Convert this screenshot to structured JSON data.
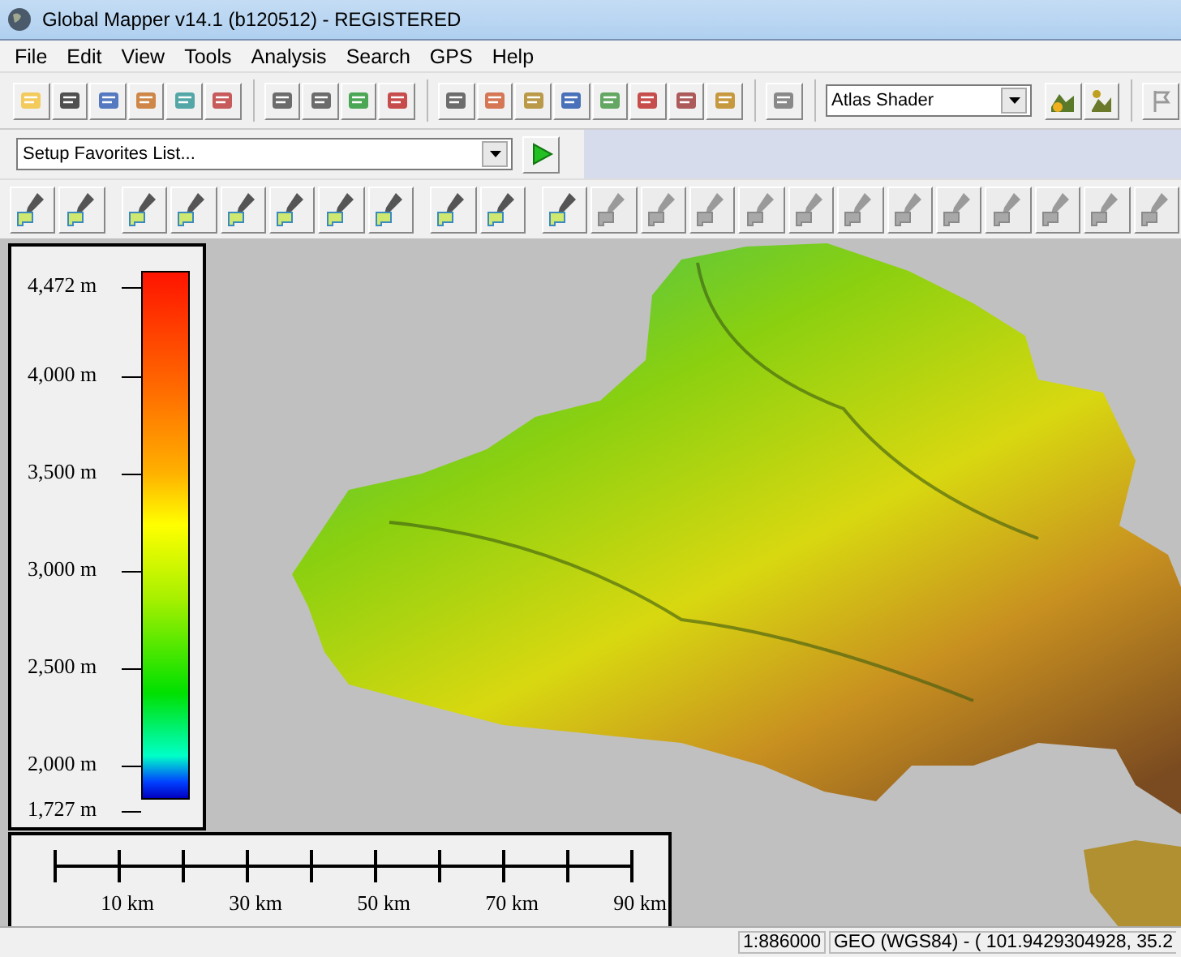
{
  "window": {
    "title": "Global Mapper v14.1 (b120512) - REGISTERED"
  },
  "menu": [
    "File",
    "Edit",
    "View",
    "Tools",
    "Analysis",
    "Search",
    "GPS",
    "Help"
  ],
  "favorites": {
    "value": "Setup Favorites List..."
  },
  "shader": {
    "value": "Atlas Shader"
  },
  "edit_toolbar": [
    {
      "disabled": false
    },
    {
      "disabled": false
    },
    {
      "disabled": false
    },
    {
      "disabled": false
    },
    {
      "disabled": false
    },
    {
      "disabled": false
    },
    {
      "disabled": false
    },
    {
      "disabled": false
    },
    {
      "disabled": false
    },
    {
      "disabled": false
    },
    {
      "disabled": false
    },
    {
      "disabled": true
    },
    {
      "disabled": true
    },
    {
      "disabled": true
    },
    {
      "disabled": true
    },
    {
      "disabled": true
    },
    {
      "disabled": true
    },
    {
      "disabled": true
    },
    {
      "disabled": true
    },
    {
      "disabled": true
    },
    {
      "disabled": true
    },
    {
      "disabled": true
    },
    {
      "disabled": true
    }
  ],
  "legend": {
    "labels": [
      "4,472 m",
      "4,000 m",
      "3,500 m",
      "3,000 m",
      "2,500 m",
      "2,000 m",
      "1,727 m"
    ]
  },
  "scale_bar": {
    "labels": [
      "10 km",
      "30 km",
      "50 km",
      "70 km",
      "90 km"
    ]
  },
  "status_bar": {
    "scale": "1:886000",
    "coordinates": "GEO (WGS84) - ( 101.9429304928, 35.2"
  }
}
